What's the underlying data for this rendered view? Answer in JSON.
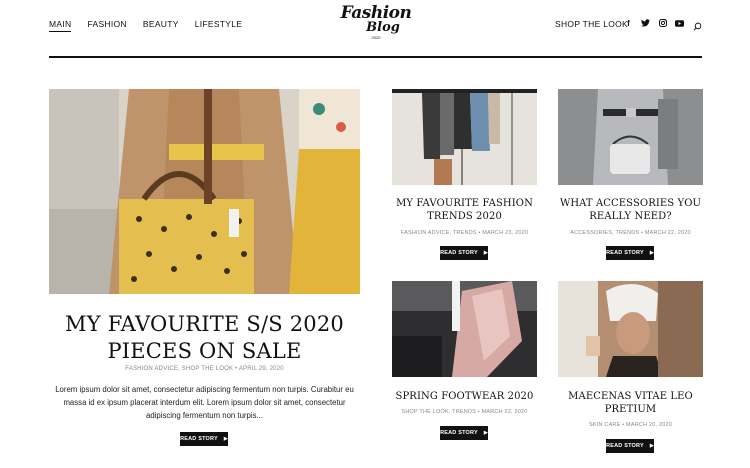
{
  "nav": {
    "items": [
      {
        "label": "MAIN"
      },
      {
        "label": "FASHION"
      },
      {
        "label": "BEAUTY"
      },
      {
        "label": "LIFESTYLE"
      }
    ]
  },
  "logo": {
    "line1": "Fashion",
    "line2": "Blog",
    "line3": "2020"
  },
  "header": {
    "shop_label": "SHOP THE LOOK"
  },
  "social": {
    "facebook": "f",
    "twitter": "t",
    "instagram": "◎",
    "youtube": "▶"
  },
  "featured": {
    "title": "MY FAVOURITE S/S 2020 PIECES ON SALE",
    "meta": "FASHION ADVICE, SHOP THE LOOK  •  APRIL 29, 2020",
    "excerpt": "Lorem ipsum dolor sit amet, consectetur adipiscing fermentum non turpis. Curabitur eu massa id ex ipsum placerat interdum elit. Lorem ipsum dolor sit amet, consectetur adipiscing fermentum non turpis...",
    "button": "READ STORY"
  },
  "posts": [
    {
      "title": "MY FAVOURITE FASHION TRENDS 2020",
      "meta": "FASHION ADVICE, TRENDS  •  MARCH 23, 2020",
      "button": "READ STORY"
    },
    {
      "title": "WHAT ACCESSORIES YOU REALLY NEED?",
      "meta": "ACCESSORIES, TRENDS  •  MARCH 22, 2020",
      "button": "READ STORY"
    },
    {
      "title": "SPRING FOOTWEAR 2020",
      "meta": "SHOP THE LOOK, TRENDS  •  MARCH 22, 2020",
      "button": "READ STORY"
    },
    {
      "title": "MAECENAS VITAE LEO PRETIUM",
      "meta": "SKIN CARE  •  MARCH 20, 2020",
      "button": "READ STORY"
    }
  ],
  "colors": {
    "accent": "#111111",
    "meta_gray": "#888888",
    "yellow": "#e2b43a"
  }
}
